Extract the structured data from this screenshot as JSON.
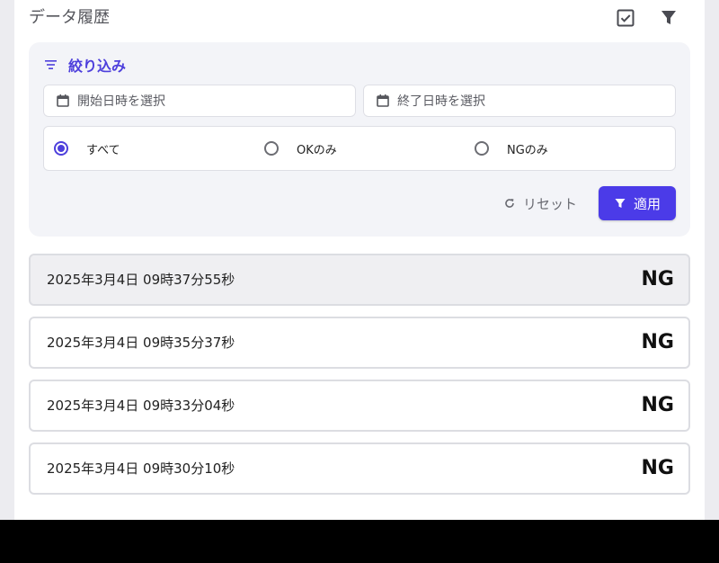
{
  "page": {
    "title": "データ履歴",
    "icons": {
      "select": "checkbox-checked-icon",
      "filter": "funnel-icon"
    }
  },
  "filter": {
    "heading": "絞り込み",
    "start_placeholder": "開始日時を選択",
    "end_placeholder": "終了日時を選択",
    "options": [
      {
        "label": "すべて",
        "checked": true
      },
      {
        "label": "OKのみ",
        "checked": false
      },
      {
        "label": "NGのみ",
        "checked": false
      }
    ],
    "reset_label": "リセット",
    "apply_label": "適用"
  },
  "records": [
    {
      "timestamp": "2025年3月4日 09時37分55秒",
      "result": "NG",
      "selected": true
    },
    {
      "timestamp": "2025年3月4日 09時35分37秒",
      "result": "NG",
      "selected": false
    },
    {
      "timestamp": "2025年3月4日 09時33分04秒",
      "result": "NG",
      "selected": false
    },
    {
      "timestamp": "2025年3月4日 09時30分10秒",
      "result": "NG",
      "selected": false
    }
  ],
  "colors": {
    "accent": "#4b3be8",
    "card_bg": "#f3f4f8",
    "border": "#dcdde2"
  }
}
